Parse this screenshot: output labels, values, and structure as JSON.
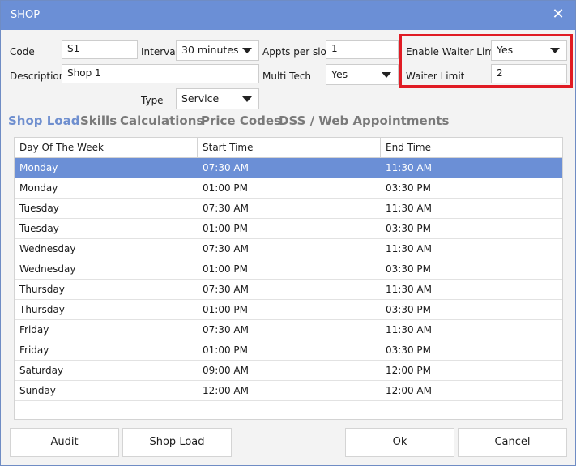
{
  "window": {
    "title": "SHOP",
    "close_glyph": "✕"
  },
  "fields": {
    "code_label": "Code",
    "code_value": "S1",
    "interval_label": "Interval",
    "interval_value": "30 minutes",
    "appts_label": "Appts per slot",
    "appts_value": "1",
    "enable_waiter_label": "Enable Waiter Limit",
    "enable_waiter_value": "Yes",
    "description_label": "Description",
    "description_value": "Shop 1",
    "multitech_label": "Multi Tech",
    "multitech_value": "Yes",
    "waiter_limit_label": "Waiter Limit",
    "waiter_limit_value": "2",
    "type_label": "Type",
    "type_value": "Service"
  },
  "tabs": [
    {
      "label": "Shop Load",
      "active": true
    },
    {
      "label": "Skills"
    },
    {
      "label": "Calculations"
    },
    {
      "label": "Price Codes"
    },
    {
      "label": "DSS / Web Appointments"
    }
  ],
  "grid": {
    "columns": [
      "Day Of The Week",
      "Start Time",
      "End Time"
    ],
    "rows": [
      [
        "Monday",
        "07:30 AM",
        "11:30 AM"
      ],
      [
        "Monday",
        "01:00 PM",
        "03:30 PM"
      ],
      [
        "Tuesday",
        "07:30 AM",
        "11:30 AM"
      ],
      [
        "Tuesday",
        "01:00 PM",
        "03:30 PM"
      ],
      [
        "Wednesday",
        "07:30 AM",
        "11:30 AM"
      ],
      [
        "Wednesday",
        "01:00 PM",
        "03:30 PM"
      ],
      [
        "Thursday",
        "07:30 AM",
        "11:30 AM"
      ],
      [
        "Thursday",
        "01:00 PM",
        "03:30 PM"
      ],
      [
        "Friday",
        "07:30 AM",
        "11:30 AM"
      ],
      [
        "Friday",
        "01:00 PM",
        "03:30 PM"
      ],
      [
        "Saturday",
        "09:00 AM",
        "12:00 PM"
      ],
      [
        "Sunday",
        "12:00 AM",
        "12:00 AM"
      ]
    ],
    "selected_row": 0
  },
  "buttons": {
    "audit": "Audit",
    "shop_load": "Shop Load",
    "ok": "Ok",
    "cancel": "Cancel"
  },
  "colors": {
    "accent": "#6b8fd6",
    "highlight_border": "#e01b24"
  }
}
